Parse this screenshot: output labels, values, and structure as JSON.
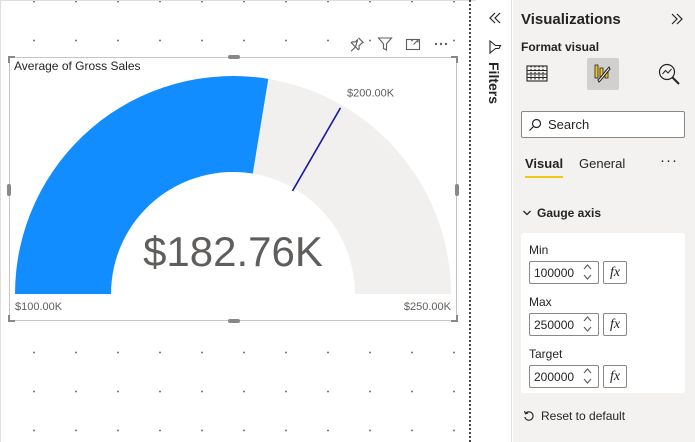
{
  "visual": {
    "title": "Average of Gross Sales",
    "header_icons": [
      "pin-icon",
      "filter-icon",
      "focus-mode-icon",
      "more-options-icon"
    ]
  },
  "chart_data": {
    "type": "gauge",
    "title": "Average of Gross Sales",
    "value": 182760,
    "value_label": "$182.76K",
    "min": 100000,
    "min_label": "$100.00K",
    "max": 250000,
    "max_label": "$250.00K",
    "target": 200000,
    "target_label": "$200.00K",
    "fill_color": "#118DFF",
    "track_color": "#F1F0EF",
    "target_color": "#1A1A9C",
    "value_text_color": "#605E5C"
  },
  "filters": {
    "label": "Filters"
  },
  "pane": {
    "title": "Visualizations",
    "subtitle": "Format visual",
    "search_placeholder": "Search",
    "tabs": [
      "Visual",
      "General"
    ],
    "active_tab": "Visual",
    "section": "Gauge axis",
    "fields": {
      "min_label": "Min",
      "min_value": "100000",
      "max_label": "Max",
      "max_value": "250000",
      "target_label": "Target",
      "target_value": "200000",
      "fx_label": "fx"
    },
    "reset_label": "Reset to default",
    "accent_color": "#F2C811"
  }
}
